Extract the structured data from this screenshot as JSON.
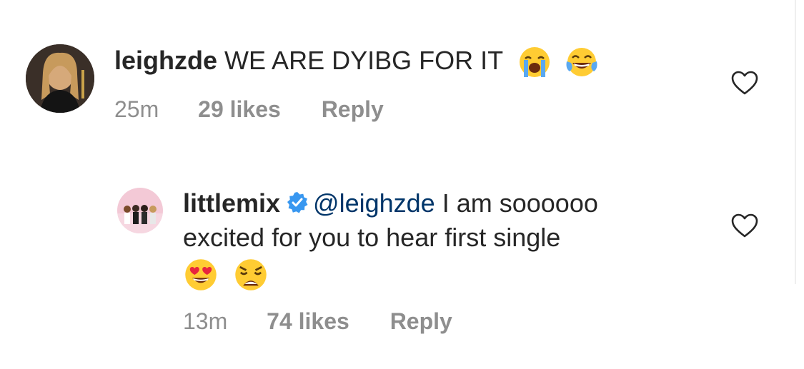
{
  "comments": [
    {
      "username": "leighzde",
      "text": "WE ARE DYIBG FOR IT",
      "emojis": [
        "crying-face-emoji",
        "tears-of-joy-emoji"
      ],
      "time": "25m",
      "likes": "29 likes",
      "reply_label": "Reply"
    },
    {
      "username": "littlemix",
      "verified": true,
      "mention": "@leighzde",
      "text_line1": "I am soooooo",
      "text_line2": "excited for you to hear first single",
      "emojis": [
        "heart-eyes-emoji",
        "weary-face-emoji"
      ],
      "time": "13m",
      "likes": "74 likes",
      "reply_label": "Reply"
    }
  ],
  "colors": {
    "text": "#262626",
    "muted": "#8e8e8e",
    "mention": "#003569",
    "verified_blue": "#3897f0"
  }
}
